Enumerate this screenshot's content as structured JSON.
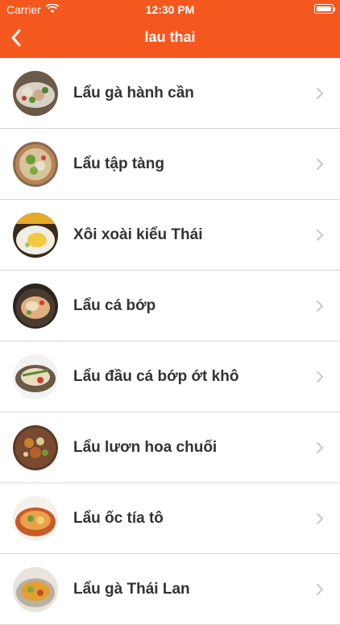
{
  "status": {
    "carrier": "Carrier",
    "time": "12:30 PM"
  },
  "nav": {
    "title": "lau thai",
    "back_icon": "chevron-left-icon"
  },
  "colors": {
    "brand": "#f4581f",
    "text": "#333333",
    "separator": "#d7d7d7",
    "chevron": "#c7c7cc"
  },
  "items": [
    {
      "label": "Lẩu gà hành cần"
    },
    {
      "label": "Lẩu tập tàng"
    },
    {
      "label": "Xôi xoài kiểu Thái"
    },
    {
      "label": "Lẩu cá bớp"
    },
    {
      "label": "Lẩu đầu cá bớp ớt khô"
    },
    {
      "label": "Lẩu lươn hoa chuối"
    },
    {
      "label": "Lẩu ốc tía tô"
    },
    {
      "label": "Lẩu gà Thái Lan"
    }
  ]
}
